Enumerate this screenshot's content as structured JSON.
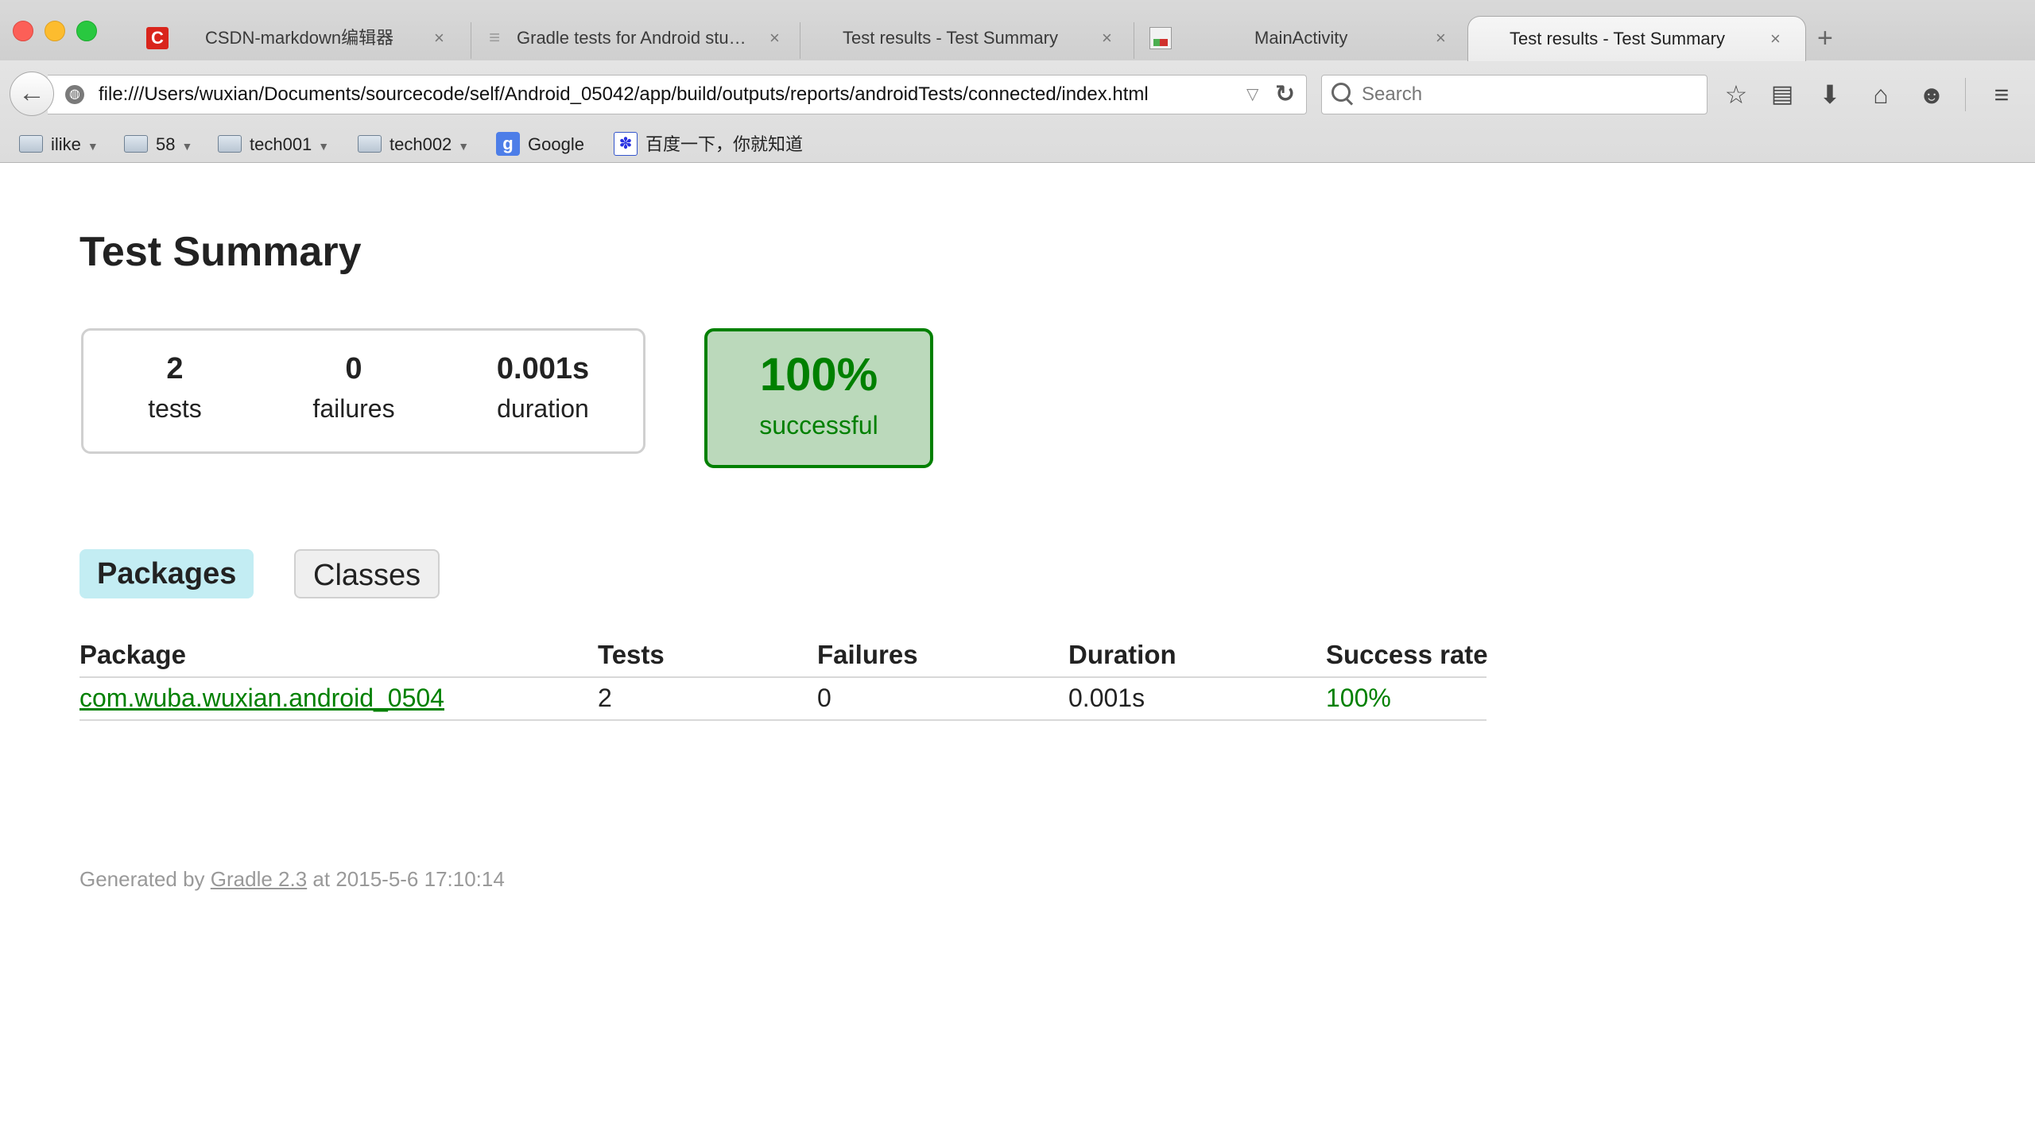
{
  "browser": {
    "tabs": [
      {
        "title": "CSDN-markdown编辑器",
        "icon": "csdn-icon"
      },
      {
        "title": "Gradle tests for Android stu…",
        "icon": "stackoverflow-icon"
      },
      {
        "title": "Test results - Test Summary",
        "icon": "none"
      },
      {
        "title": "MainActivity",
        "icon": "document-icon"
      },
      {
        "title": "Test results - Test Summary",
        "icon": "none",
        "active": true
      }
    ],
    "close_glyph": "×",
    "new_tab_glyph": "+",
    "url": "file:///Users/wuxian/Documents/sourcecode/self/Android_05042/app/build/outputs/reports/androidTests/connected/index.html",
    "search_placeholder": "Search",
    "bookmarks": [
      {
        "label": "ilike",
        "type": "folder"
      },
      {
        "label": "58",
        "type": "folder"
      },
      {
        "label": "tech001",
        "type": "folder"
      },
      {
        "label": "tech002",
        "type": "folder"
      },
      {
        "label": "Google",
        "type": "link"
      },
      {
        "label": "百度一下，你就知道",
        "type": "link"
      }
    ]
  },
  "report": {
    "title": "Test Summary",
    "counters": {
      "tests": {
        "value": "2",
        "label": "tests"
      },
      "failures": {
        "value": "0",
        "label": "failures"
      },
      "duration": {
        "value": "0.001s",
        "label": "duration"
      }
    },
    "success": {
      "value": "100%",
      "label": "successful"
    },
    "tabs": {
      "packages": "Packages",
      "classes": "Classes"
    },
    "table": {
      "headers": [
        "Package",
        "Tests",
        "Failures",
        "Duration",
        "Success rate"
      ],
      "rows": [
        [
          "com.wuba.wuxian.android_0504",
          "2",
          "0",
          "0.001s",
          "100%"
        ]
      ]
    },
    "footer": {
      "prefix": "Generated by ",
      "link": "Gradle 2.3",
      "suffix": " at 2015-5-6 17:10:14"
    }
  },
  "colors": {
    "success_green": "#008000",
    "success_bg": "#bbd9bb",
    "selected_tab_bg": "#c3edf3"
  }
}
